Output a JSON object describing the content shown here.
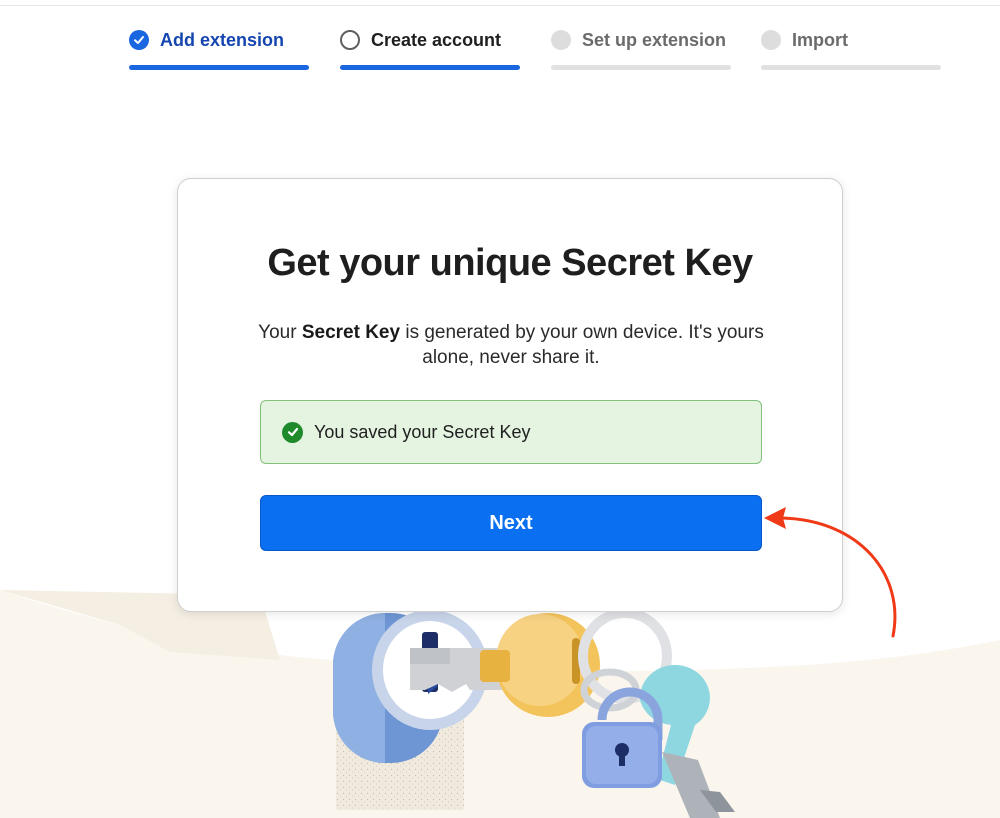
{
  "stepper": {
    "steps": [
      {
        "label": "Add extension",
        "state": "complete"
      },
      {
        "label": "Create account",
        "state": "current"
      },
      {
        "label": "Set up extension",
        "state": "upcoming"
      },
      {
        "label": "Import",
        "state": "upcoming"
      }
    ]
  },
  "card": {
    "title": "Get your unique Secret Key",
    "description": {
      "prefix": "Your ",
      "bold": "Secret Key",
      "suffix": " is generated by your own device. It's yours alone, never share it."
    },
    "success_message": "You saved your Secret Key",
    "next_label": "Next"
  },
  "colors": {
    "accent": "#0a6ff0",
    "stepper_active": "#1a66e0",
    "success_bg": "#e4f4e1",
    "success_icon": "#1f8a2b",
    "annotation_arrow": "#f03a17",
    "background_wave": "#faf6ee"
  },
  "icons": {
    "step_complete": "check-circle-icon",
    "step_current": "empty-circle-icon",
    "step_upcoming": "gray-dot-icon",
    "success": "check-circle-icon"
  }
}
